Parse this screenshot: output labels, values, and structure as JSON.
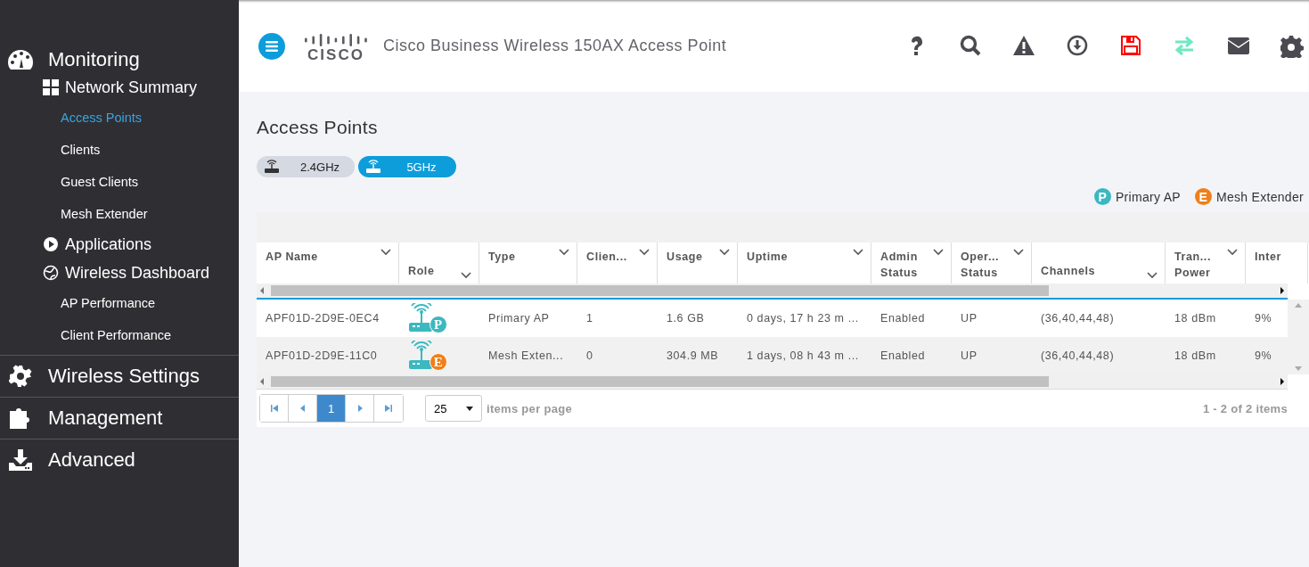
{
  "sidebar": {
    "sections": [
      {
        "label": "Monitoring",
        "expanded": true,
        "children": [
          {
            "label": "Network Summary",
            "children": [
              {
                "label": "Access Points",
                "selected": true
              },
              {
                "label": "Clients",
                "selected": false
              },
              {
                "label": "Guest Clients",
                "selected": false
              },
              {
                "label": "Mesh Extender",
                "selected": false
              }
            ]
          },
          {
            "label": "Applications"
          },
          {
            "label": "Wireless Dashboard",
            "children": [
              {
                "label": "AP Performance",
                "selected": false
              },
              {
                "label": "Client Performance",
                "selected": false
              }
            ]
          }
        ]
      },
      {
        "label": "Wireless Settings",
        "expanded": false
      },
      {
        "label": "Management",
        "expanded": false
      },
      {
        "label": "Advanced",
        "expanded": false
      }
    ]
  },
  "header": {
    "logo": "CISCO",
    "title": "Cisco Business Wireless 150AX Access Point"
  },
  "page": {
    "title": "Access Points",
    "tabs": [
      {
        "label": "2.4GHz",
        "selected": false
      },
      {
        "label": "5GHz",
        "selected": true
      }
    ],
    "legend": [
      {
        "badge": "P",
        "label": "Primary AP",
        "color": "#3bb8c0"
      },
      {
        "badge": "E",
        "label": "Mesh Extender",
        "color": "#ef7f1a"
      }
    ],
    "table": {
      "columns": [
        "AP Name",
        "Role",
        "Type",
        "Clien...",
        "Usage",
        "Uptime",
        "Admin Status",
        "Oper... Status",
        "Channels",
        "Tran... Power",
        "Inter"
      ],
      "rows": [
        {
          "ap_name": "APF01D-2D9E-0EC4",
          "role": {
            "badge": "P",
            "color": "#3bb8c0"
          },
          "type": "Primary AP",
          "clients": "1",
          "usage": "1.6 GB",
          "uptime": "0 days, 17 h 23 m ...",
          "admin_status": "Enabled",
          "oper_status": "UP",
          "channels": "(36,40,44,48)",
          "power": "18 dBm",
          "inter": "9%"
        },
        {
          "ap_name": "APF01D-2D9E-11C0",
          "role": {
            "badge": "E",
            "color": "#ef7f1a"
          },
          "type": "Mesh Exten...",
          "clients": "0",
          "usage": "304.9 MB",
          "uptime": "1 days, 08 h 43 m ...",
          "admin_status": "Enabled",
          "oper_status": "UP",
          "channels": "(36,40,44,48)",
          "power": "18 dBm",
          "inter": "9%"
        }
      ]
    },
    "pager": {
      "page": "1",
      "page_size": "25",
      "page_size_label": "items per page",
      "summary": "1 - 2 of 2 items"
    }
  }
}
